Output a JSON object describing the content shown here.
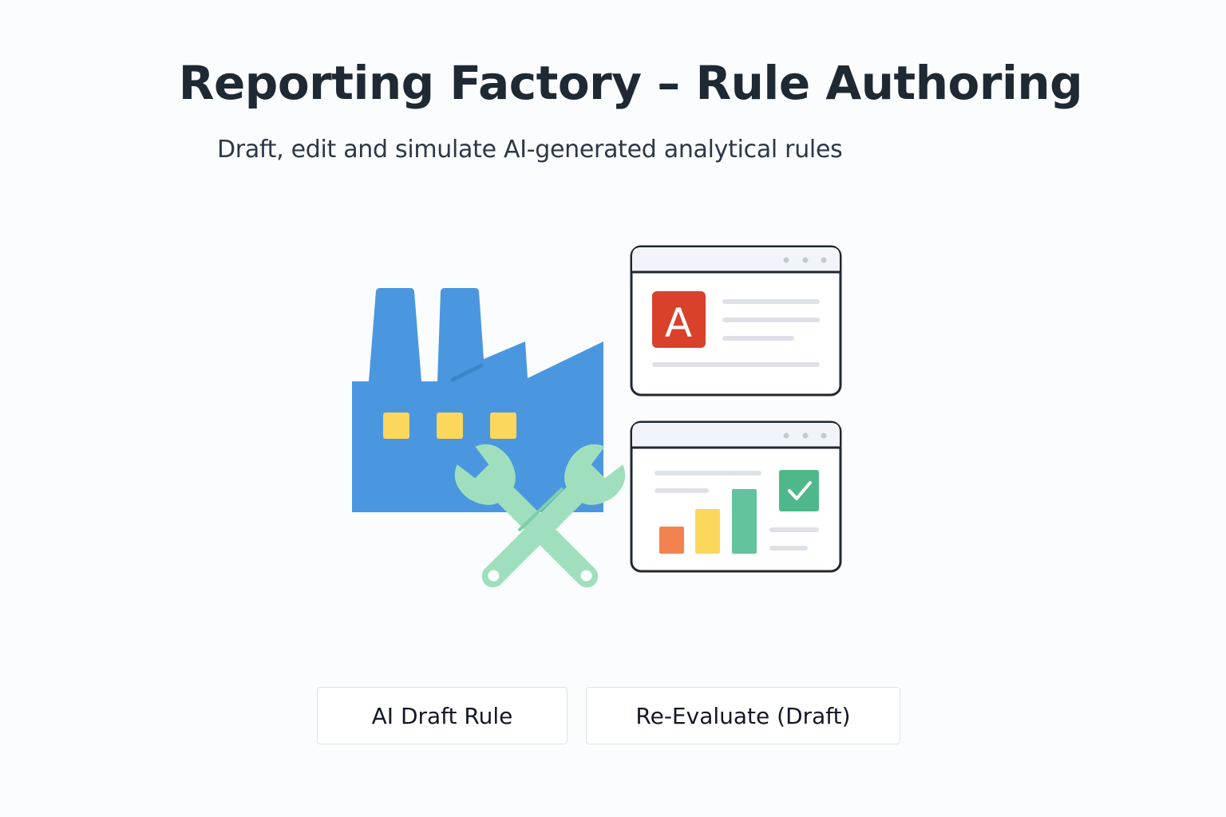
{
  "header": {
    "title": "Reporting Factory – Rule Authoring",
    "subtitle": "Draft, edit and simulate AI-generated analytical rules"
  },
  "illustration": {
    "factory_icon": "factory-icon",
    "tools_icon": "crossed-wrenches-icon",
    "rule_window": {
      "badge_letter": "A",
      "badge_color": "#d9412b"
    },
    "results_window": {
      "check_icon": "checkmark-icon",
      "check_color": "#4fb88a"
    },
    "colors": {
      "factory": "#4a97e0",
      "factory_windows": "#fbd75b",
      "wrench": "#9fdfbd",
      "bar_orange": "#f4824f",
      "bar_yellow": "#fbd75b",
      "bar_green": "#62c39d",
      "window_border": "#1f2933"
    }
  },
  "actions": {
    "draft_label": "AI Draft Rule",
    "reevaluate_label": "Re-Evaluate (Draft)"
  }
}
